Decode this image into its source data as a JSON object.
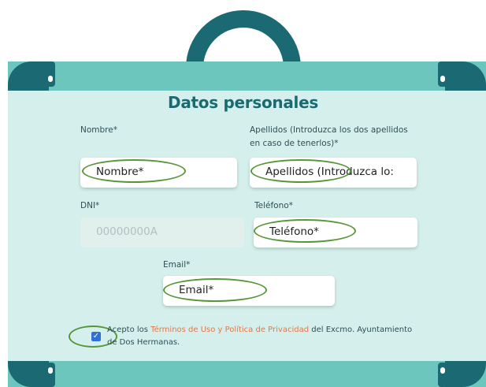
{
  "form": {
    "title": "Datos personales",
    "nombre": {
      "label": "Nombre*",
      "placeholder": "Nombre*"
    },
    "apellidos": {
      "label_line1": "Apellidos (Introduzca los dos apellidos",
      "label_line2": "en caso de tenerlos)*",
      "placeholder": "Apellidos (Introduzca lo:"
    },
    "dni": {
      "label": "DNI*",
      "value": "00000000A"
    },
    "telefono": {
      "label": "Teléfono*",
      "placeholder": "Teléfono*"
    },
    "email": {
      "label": "Email*",
      "placeholder": "Email*"
    },
    "terms": {
      "checked": true,
      "prefix": "Acepto los ",
      "link": "Términos de Uso y Política de Privacidad",
      "suffix": " del Excmo. Ayuntamiento de Dos Hermanas."
    }
  },
  "colors": {
    "teal_dark": "#1b6a73",
    "teal_light": "#6dc6bd",
    "panel": "#d5f0ec",
    "link": "#e0784a",
    "annotation": "#58963a"
  }
}
